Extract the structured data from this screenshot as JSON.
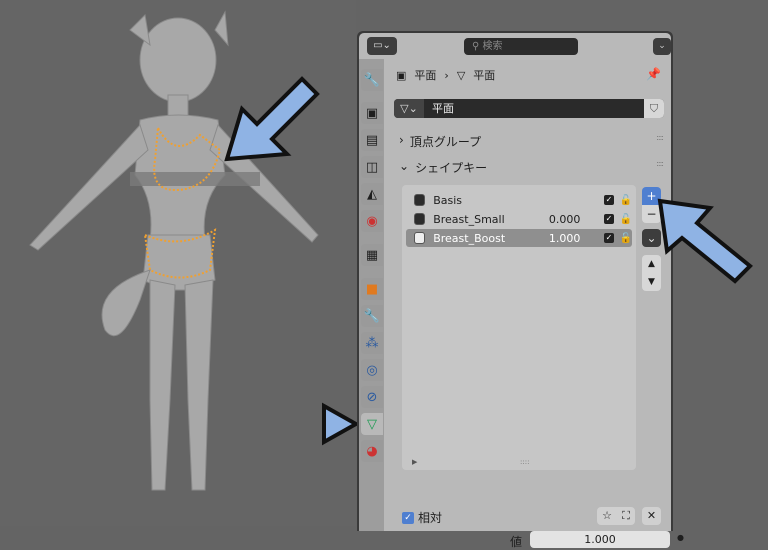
{
  "header": {
    "search_placeholder": "検索"
  },
  "breadcrumb": {
    "object": "平面",
    "mesh": "平面"
  },
  "mesh_name": "平面",
  "sections": {
    "vertex_groups": "頂点グループ",
    "shape_keys": "シェイプキー"
  },
  "shape_keys": [
    {
      "name": "Basis",
      "value": "",
      "enabled": true,
      "selected": false
    },
    {
      "name": "Breast_Small",
      "value": "0.000",
      "enabled": true,
      "selected": false
    },
    {
      "name": "Breast_Boost",
      "value": "1.000",
      "enabled": true,
      "selected": true
    }
  ],
  "relative": {
    "label": "相対",
    "checked": true
  },
  "value": {
    "label": "値",
    "value": "1.000"
  },
  "buttons": {
    "add": "+",
    "remove": "−",
    "specials": "⌄",
    "up": "▲",
    "down": "▼",
    "clear": "✕"
  },
  "colors": {
    "accent": "#4f7fd0",
    "arrow": "#8fb3e4",
    "selection": "#f0a030"
  }
}
